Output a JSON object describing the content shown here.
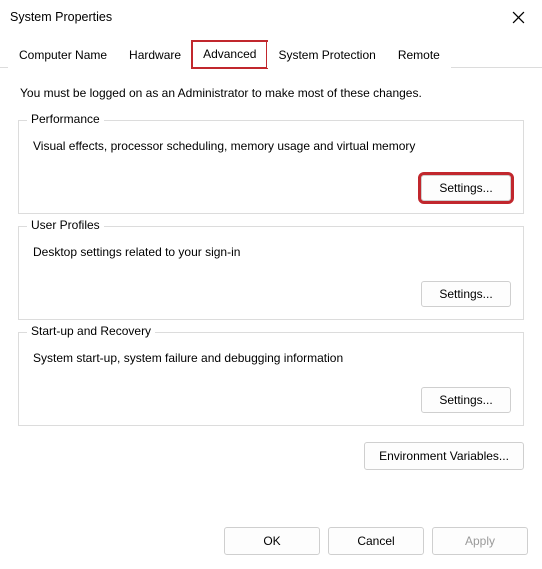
{
  "window": {
    "title": "System Properties"
  },
  "tabs": {
    "computer_name": "Computer Name",
    "hardware": "Hardware",
    "advanced": "Advanced",
    "system_protection": "System Protection",
    "remote": "Remote"
  },
  "panel": {
    "intro": "You must be logged on as an Administrator to make most of these changes.",
    "performance": {
      "legend": "Performance",
      "desc": "Visual effects, processor scheduling, memory usage and virtual memory",
      "settings_label": "Settings..."
    },
    "user_profiles": {
      "legend": "User Profiles",
      "desc": "Desktop settings related to your sign-in",
      "settings_label": "Settings..."
    },
    "startup_recovery": {
      "legend": "Start-up and Recovery",
      "desc": "System start-up, system failure and debugging information",
      "settings_label": "Settings..."
    },
    "env_vars_label": "Environment Variables..."
  },
  "footer": {
    "ok": "OK",
    "cancel": "Cancel",
    "apply": "Apply"
  }
}
